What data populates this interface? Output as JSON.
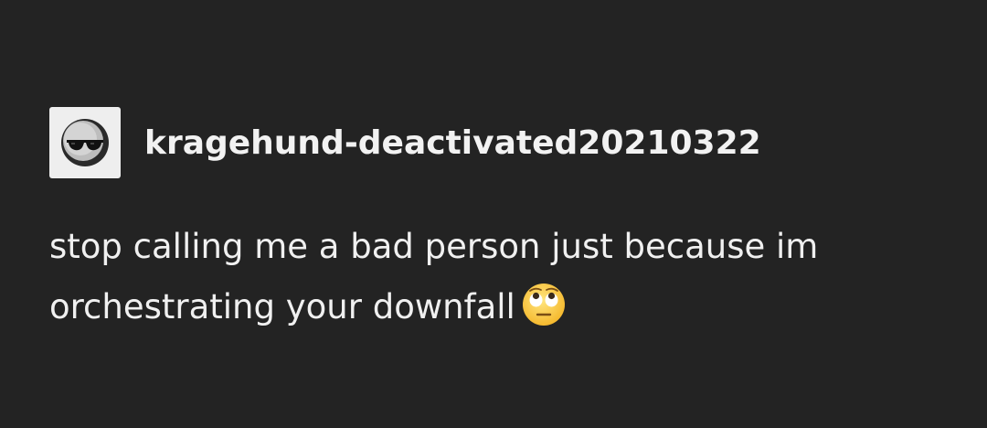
{
  "post": {
    "username": "kragehund-deactivated20210322",
    "avatar_icon": "sunglasses-avatar-icon",
    "body_text": "stop calling me a bad person just because im orchestrating your downfall",
    "emoji_icon": "face-with-rolling-eyes-icon"
  },
  "colors": {
    "background": "#232323",
    "text": "#f0f0f0",
    "avatar_bg": "#eeeeee"
  }
}
